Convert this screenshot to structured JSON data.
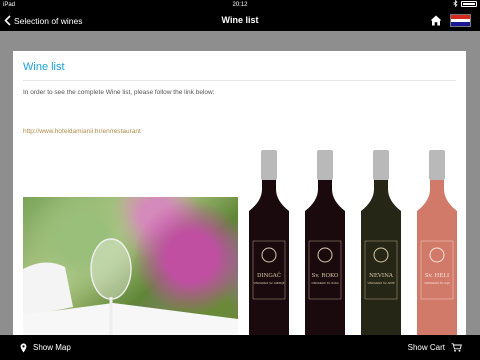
{
  "status_bar": {
    "device": "iPad",
    "time": "20:12"
  },
  "nav_bar": {
    "back_label": "Selection of wines",
    "title": "Wine list",
    "flag_colors": [
      "#d52b1e",
      "#ffffff",
      "#171796"
    ]
  },
  "info_card": {
    "title": "Wine list",
    "text": "In order to see the complete Wine list, please follow the link below:",
    "link": "http://www.hoteldamianii.hr/en/restaurant"
  },
  "bottles": [
    {
      "name": "DINGAČ",
      "subtitle": "VINOGRADI SV. ANDRIJE",
      "glass_color": "#1a0a0d",
      "label_color": "#d9c8a8"
    },
    {
      "name": "Sv. ROKO",
      "subtitle": "VINOGRADI SV. ROKA",
      "glass_color": "#1a0a0d",
      "label_color": "#d9c8a8"
    },
    {
      "name": "NEVINA",
      "subtitle": "VINOGRADI SV. ANTE",
      "glass_color": "#262616",
      "label_color": "#d9c8a8"
    },
    {
      "name": "Sv. HELI",
      "subtitle": "VINOGRADI SV. ILIJE",
      "glass_color": "#d27a6a",
      "label_color": "#f4e6da"
    }
  ],
  "bottom_bar": {
    "show_map_label": "Show Map",
    "show_cart_label": "Show Cart"
  },
  "colors": {
    "accent": "#1aa0d8",
    "link": "#b08c4a",
    "background": "#8e8e8e",
    "bar": "#000000"
  }
}
